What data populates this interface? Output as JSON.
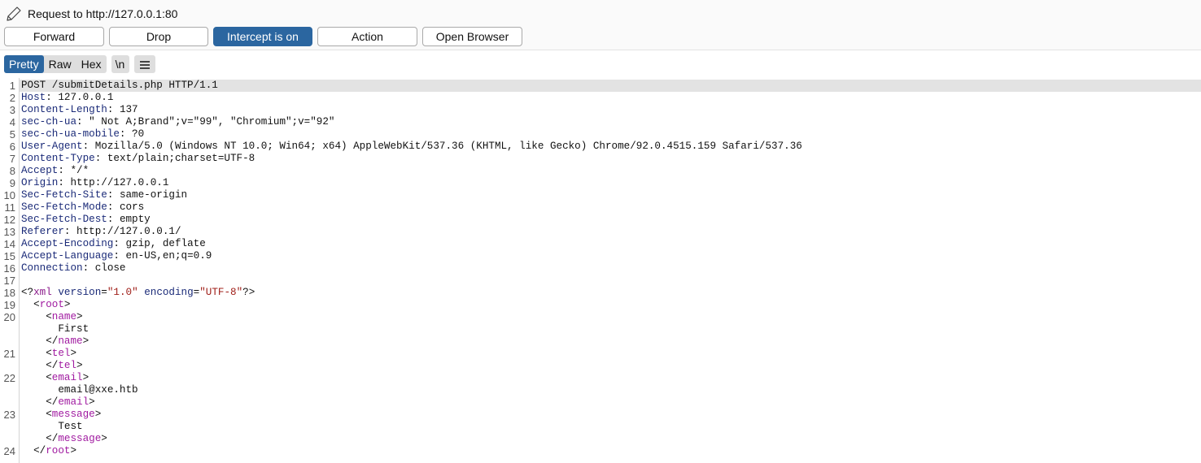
{
  "header": {
    "title": "Request to http://127.0.0.1:80",
    "icon": "pencil-icon"
  },
  "toolbar": {
    "forward_label": "Forward",
    "drop_label": "Drop",
    "intercept_label": "Intercept is on",
    "action_label": "Action",
    "open_browser_label": "Open Browser"
  },
  "view_tabs": {
    "pretty": "Pretty",
    "raw": "Raw",
    "hex": "Hex",
    "active": "Pretty",
    "newline_label": "\\n",
    "menu_icon": "hamburger-icon"
  },
  "colors": {
    "accent": "#2b66a0",
    "header_name": "#1a2a78",
    "xml_tag": "#a01aa0",
    "xml_string": "#a0201a"
  },
  "request": {
    "request_line": "POST /submitDetails.php HTTP/1.1",
    "headers": [
      {
        "num": "2",
        "name": "Host",
        "value": "127.0.0.1"
      },
      {
        "num": "3",
        "name": "Content-Length",
        "value": "137"
      },
      {
        "num": "4",
        "name": "sec-ch-ua",
        "value": "\" Not A;Brand\";v=\"99\", \"Chromium\";v=\"92\""
      },
      {
        "num": "5",
        "name": "sec-ch-ua-mobile",
        "value": "?0"
      },
      {
        "num": "6",
        "name": "User-Agent",
        "value": "Mozilla/5.0 (Windows NT 10.0; Win64; x64) AppleWebKit/537.36 (KHTML, like Gecko) Chrome/92.0.4515.159 Safari/537.36"
      },
      {
        "num": "7",
        "name": "Content-Type",
        "value": "text/plain;charset=UTF-8"
      },
      {
        "num": "8",
        "name": "Accept",
        "value": "*/*"
      },
      {
        "num": "9",
        "name": "Origin",
        "value": "http://127.0.0.1"
      },
      {
        "num": "10",
        "name": "Sec-Fetch-Site",
        "value": "same-origin"
      },
      {
        "num": "11",
        "name": "Sec-Fetch-Mode",
        "value": "cors"
      },
      {
        "num": "12",
        "name": "Sec-Fetch-Dest",
        "value": "empty"
      },
      {
        "num": "13",
        "name": "Referer",
        "value": "http://127.0.0.1/"
      },
      {
        "num": "14",
        "name": "Accept-Encoding",
        "value": "gzip, deflate"
      },
      {
        "num": "15",
        "name": "Accept-Language",
        "value": "en-US,en;q=0.9"
      },
      {
        "num": "16",
        "name": "Connection",
        "value": "close"
      }
    ],
    "xml_decl": {
      "num": "18",
      "pi_name": "xml",
      "version_attr": "version",
      "version_val": "\"1.0\"",
      "encoding_attr": "encoding",
      "encoding_val": "\"UTF-8\""
    },
    "body": [
      {
        "num": "19",
        "indent": 1,
        "kind": "open",
        "tag": "root"
      },
      {
        "num": "20",
        "indent": 2,
        "kind": "open",
        "tag": "name"
      },
      {
        "num": "",
        "indent": 3,
        "kind": "text",
        "text": "First"
      },
      {
        "num": "",
        "indent": 2,
        "kind": "close",
        "tag": "name"
      },
      {
        "num": "21",
        "indent": 2,
        "kind": "open",
        "tag": "tel"
      },
      {
        "num": "",
        "indent": 2,
        "kind": "close",
        "tag": "tel"
      },
      {
        "num": "22",
        "indent": 2,
        "kind": "open",
        "tag": "email"
      },
      {
        "num": "",
        "indent": 3,
        "kind": "text",
        "text": "email@xxe.htb"
      },
      {
        "num": "",
        "indent": 2,
        "kind": "close",
        "tag": "email"
      },
      {
        "num": "23",
        "indent": 2,
        "kind": "open",
        "tag": "message"
      },
      {
        "num": "",
        "indent": 3,
        "kind": "text",
        "text": "Test"
      },
      {
        "num": "",
        "indent": 2,
        "kind": "close",
        "tag": "message"
      },
      {
        "num": "24",
        "indent": 1,
        "kind": "close",
        "tag": "root"
      }
    ]
  }
}
